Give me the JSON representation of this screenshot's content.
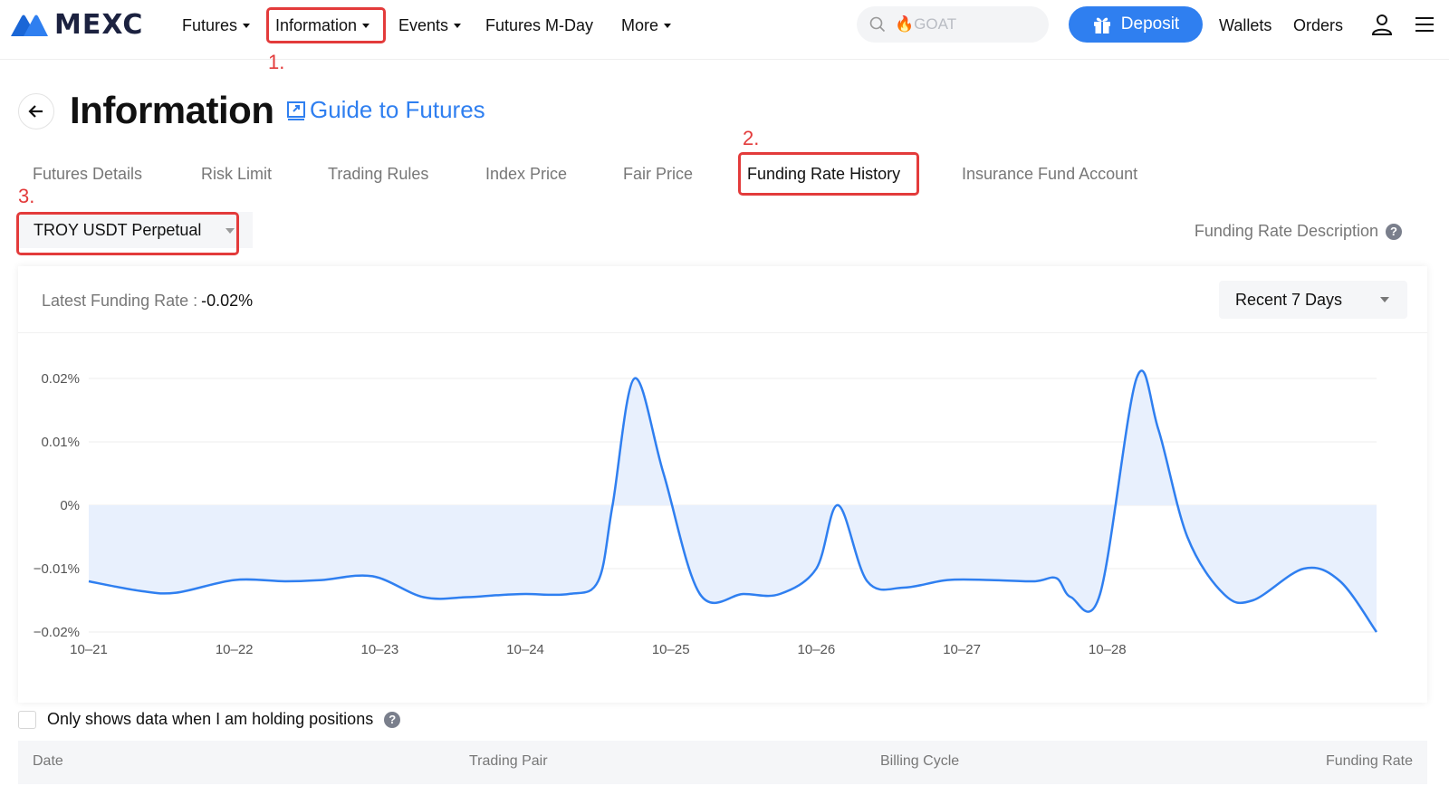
{
  "brand": {
    "name": "MEXC",
    "accent": "#2f7ff0",
    "annotation_color": "#e33b3b"
  },
  "nav": {
    "items": [
      {
        "label": "Futures",
        "caret": true
      },
      {
        "label": "Information",
        "caret": true
      },
      {
        "label": "Events",
        "caret": true
      },
      {
        "label": "Futures M-Day",
        "caret": false
      },
      {
        "label": "More",
        "caret": true
      }
    ],
    "search_placeholder": "🔥GOAT",
    "deposit_label": "Deposit",
    "wallets_label": "Wallets",
    "orders_label": "Orders",
    "icons": [
      "search-icon",
      "gift-icon",
      "user-icon",
      "menu-icon"
    ]
  },
  "header": {
    "title": "Information",
    "guide_link": "Guide to Futures"
  },
  "tabs": [
    {
      "label": "Futures Details",
      "active": false
    },
    {
      "label": "Risk Limit",
      "active": false
    },
    {
      "label": "Trading Rules",
      "active": false
    },
    {
      "label": "Index Price",
      "active": false
    },
    {
      "label": "Fair Price",
      "active": false
    },
    {
      "label": "Funding Rate History",
      "active": true
    },
    {
      "label": "Insurance Fund Account",
      "active": false
    }
  ],
  "annotations": [
    "1.",
    "2.",
    "3."
  ],
  "contract_select": {
    "value": "TROY USDT Perpetual"
  },
  "funding_rate_description": "Funding Rate Description",
  "latest_funding": {
    "label": "Latest Funding Rate :",
    "value": "-0.02%"
  },
  "range_select": {
    "value": "Recent 7 Days"
  },
  "filter": {
    "label": "Only shows data when I am holding positions",
    "checked": false
  },
  "table": {
    "columns": [
      "Date",
      "Trading Pair",
      "Billing Cycle",
      "Funding Rate"
    ]
  },
  "chart_data": {
    "type": "area",
    "title": "",
    "xlabel": "",
    "ylabel": "",
    "ylim": [
      -0.02,
      0.02
    ],
    "yticks": [
      "0.02%",
      "0.01%",
      "0%",
      "−0.01%",
      "−0.02%"
    ],
    "xticks": [
      "10–21",
      "10–22",
      "10–23",
      "10–24",
      "10–25",
      "10–26",
      "10–27",
      "10–28"
    ],
    "grid": true,
    "legend": "none",
    "line_color": "#2f7ff0",
    "fill_color": "#e8f0fd",
    "x": [
      0,
      0.35,
      0.6,
      1.0,
      1.35,
      1.6,
      1.95,
      2.3,
      2.6,
      2.8,
      3.0,
      3.3,
      3.5,
      3.6,
      3.75,
      3.95,
      4.2,
      4.5,
      4.75,
      5.0,
      5.15,
      5.35,
      5.6,
      5.9,
      6.2,
      6.5,
      6.65,
      6.75,
      6.95,
      7.2,
      7.35,
      7.55,
      7.8,
      8.0,
      8.35,
      8.6,
      8.85
    ],
    "y": [
      -0.012,
      -0.0135,
      -0.0138,
      -0.0118,
      -0.012,
      -0.0118,
      -0.0112,
      -0.0145,
      -0.0145,
      -0.0142,
      -0.014,
      -0.014,
      -0.012,
      0.0,
      0.02,
      0.005,
      -0.014,
      -0.014,
      -0.014,
      -0.01,
      0.0,
      -0.012,
      -0.013,
      -0.0118,
      -0.0118,
      -0.012,
      -0.0115,
      -0.0145,
      -0.014,
      0.02,
      0.012,
      -0.005,
      -0.014,
      -0.015,
      -0.01,
      -0.012,
      -0.02
    ]
  }
}
